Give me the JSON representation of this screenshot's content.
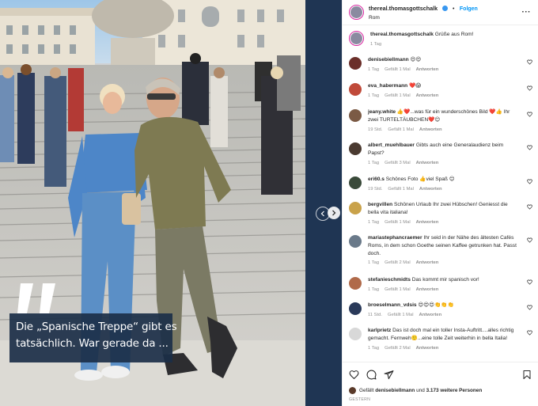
{
  "post": {
    "username": "thereal.thomasgottschalk",
    "separator": "•",
    "follow_label": "Folgen",
    "location": "Rom",
    "more_icon": "more-horizontal-icon"
  },
  "photo": {
    "overlay_lines": [
      "Die „Spanische Treppe“ gibt es",
      "tatsächlich. War gerade da ..."
    ]
  },
  "caption": {
    "username": "thereal.thomasgottschalk",
    "text": "Grüße aus Rom!",
    "time": "1 Tag"
  },
  "comments": [
    {
      "user": "denisebiellmann",
      "text": "😍😍",
      "time": "1 Tag",
      "likes": "Gefällt 1 Mal",
      "reply": "Antworten",
      "avatar_color": "#6b2f2a"
    },
    {
      "user": "eva_habermann",
      "text": "❤️😱",
      "time": "1 Tag",
      "likes": "Gefällt 1 Mal",
      "reply": "Antworten",
      "avatar_color": "#c04a3a"
    },
    {
      "user": "jeany.white",
      "text": "👍❤️...was für ein wunderschönes Bild ❤️👍 Ihr zwei TURTELTÄUBCHEN❤️😊",
      "time": "19 Std.",
      "likes": "Gefällt 1 Mal",
      "reply": "Antworten",
      "avatar_color": "#7b5a45"
    },
    {
      "user": "albert_muehlbauer",
      "text": "Gibts auch eine Generalaudienz beim Papst?",
      "time": "1 Tag",
      "likes": "Gefällt 3 Mal",
      "reply": "Antworten",
      "avatar_color": "#4a3a30"
    },
    {
      "user": "eri60.s",
      "text": "Schönes Foto 👍viel Spaß 😊",
      "time": "19 Std.",
      "likes": "Gefällt 1 Mal",
      "reply": "Antworten",
      "avatar_color": "#3a4a3a"
    },
    {
      "user": "bergvillen",
      "text": "Schönen Urlaub Ihr zwei Hübschen! Geniesst die bella vita italiana!",
      "time": "1 Tag",
      "likes": "Gefällt 1 Mal",
      "reply": "Antworten",
      "avatar_color": "#c9a24a"
    },
    {
      "user": "mariastephancraemer",
      "text": "Ihr seid in der Nähe des ältesten Cafés Roms, in dem schon Goethe seinen Kaffee getrunken hat. Passt doch.",
      "time": "1 Tag",
      "likes": "Gefällt 2 Mal",
      "reply": "Antworten",
      "avatar_color": "#6a7a8a"
    },
    {
      "user": "stefanieschmidts",
      "text": "Das kommt mir spanisch vor!",
      "time": "1 Tag",
      "likes": "Gefällt 1 Mal",
      "reply": "Antworten",
      "avatar_color": "#b06a4a"
    },
    {
      "user": "broeselmann_vdsis",
      "text": "😍😍😍👏👏👏",
      "time": "11 Std.",
      "likes": "Gefällt 1 Mal",
      "reply": "Antworten",
      "avatar_color": "#2a3a5a"
    },
    {
      "user": "karlprietz",
      "text": "Das ist doch mal ein toller Insta-Auftritt....alles richtig gemacht. Fernweh🙂...eine tolle Zeit weiterhin in bella Italia!",
      "time": "1 Tag",
      "likes": "Gefällt 2 Mal",
      "reply": "Antworten",
      "avatar_color": "#d8d8d8"
    }
  ],
  "actions": {
    "like_icon": "heart-icon",
    "comment_icon": "comment-icon",
    "share_icon": "send-icon",
    "save_icon": "bookmark-icon"
  },
  "likes": {
    "prefix": "Gefällt",
    "user": "denisebiellmann",
    "middle": "und",
    "count": "3.173 weitere Personen"
  },
  "date_label": "GESTERN",
  "colors": {
    "accent": "#0095f6",
    "caption_bg": "#1b2f48",
    "strip": "#1f3553"
  }
}
